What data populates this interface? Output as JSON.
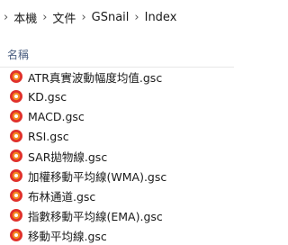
{
  "breadcrumb": [
    "本機",
    "文件",
    "GSnail",
    "Index"
  ],
  "columns": {
    "name": "名稱"
  },
  "files": [
    {
      "name": "ATR真實波動幅度均值.gsc",
      "icon": "gsc-file-icon"
    },
    {
      "name": "KD.gsc",
      "icon": "gsc-file-icon"
    },
    {
      "name": "MACD.gsc",
      "icon": "gsc-file-icon"
    },
    {
      "name": "RSI.gsc",
      "icon": "gsc-file-icon"
    },
    {
      "name": "SAR拋物線.gsc",
      "icon": "gsc-file-icon"
    },
    {
      "name": "加權移動平均線(WMA).gsc",
      "icon": "gsc-file-icon"
    },
    {
      "name": "布林通道.gsc",
      "icon": "gsc-file-icon"
    },
    {
      "name": "指數移動平均線(EMA).gsc",
      "icon": "gsc-file-icon"
    },
    {
      "name": "移動平均線.gsc",
      "icon": "gsc-file-icon"
    }
  ],
  "colors": {
    "icon_red": "#e0312b",
    "icon_orange": "#f58a22",
    "header_text": "#4d6082"
  }
}
